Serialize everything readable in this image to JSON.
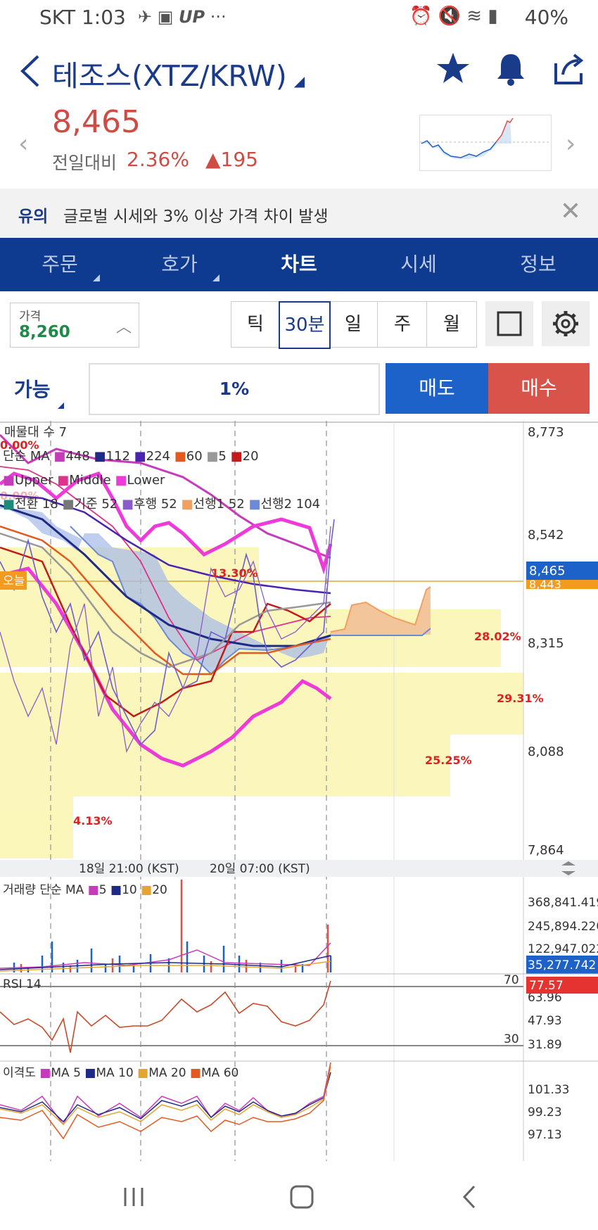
{
  "status": {
    "left": "SKT 1:03",
    "right": "40%"
  },
  "header": {
    "title": "테조스(XTZ/KRW)"
  },
  "quote": {
    "price": "8,465",
    "change_label": "전일대비",
    "change_pct": "2.36%",
    "change_val": "▲195"
  },
  "notice": {
    "tag": "유의",
    "message": "글로벌 시세와 3% 이상 가격 차이 발생"
  },
  "tabs": [
    "주문",
    "호가",
    "차트",
    "시세",
    "정보"
  ],
  "active_tab": "차트",
  "price_box": {
    "label": "가격",
    "value": "8,260"
  },
  "periods": [
    "틱",
    "30분",
    "일",
    "주",
    "월"
  ],
  "selected_period": "30분",
  "order": {
    "ability": "가능",
    "percent": "1%",
    "sell": "매도",
    "buy": "매수"
  },
  "chart_data": {
    "type": "line",
    "price_axis": [
      "8,773",
      "8,542",
      "8,315",
      "8,088",
      "7,864"
    ],
    "current_price_label": "8,465",
    "hidden_price_label": "8,443",
    "today_label": "오늘",
    "legends": {
      "volume_profile": "매물대 수 7",
      "ma": [
        "단순 MA",
        "448",
        "112",
        "224",
        "60",
        "5",
        "20"
      ],
      "bollinger": [
        "Upper",
        "Middle",
        "Lower"
      ],
      "ichimoku": [
        "전환 18",
        "기준 52",
        "후행 52",
        "선행1 52",
        "선행2 104"
      ]
    },
    "annotations": [
      "0.00%",
      "0.00%",
      "13.30%",
      "28.02%",
      "29.31%",
      "25.25%",
      "4.13%"
    ],
    "time_axis": [
      "18일 21:00 (KST)",
      "20일 07:00 (KST)"
    ],
    "volume": {
      "legend": [
        "거래량 단순 MA",
        "5",
        "10",
        "20"
      ],
      "axis": [
        "368,841.419",
        "245,894.220",
        "122,947.022"
      ],
      "current": "35,277.742"
    },
    "rsi": {
      "legend": "RSI 14",
      "levels": [
        "70",
        "30"
      ],
      "axis": [
        "63.96",
        "47.93",
        "31.89"
      ],
      "current": "77.57"
    },
    "disparity": {
      "legend": [
        "이격도",
        "MA 5",
        "MA 10",
        "MA 20",
        "MA 60"
      ],
      "axis": [
        "101.33",
        "99.23",
        "97.13"
      ]
    }
  }
}
